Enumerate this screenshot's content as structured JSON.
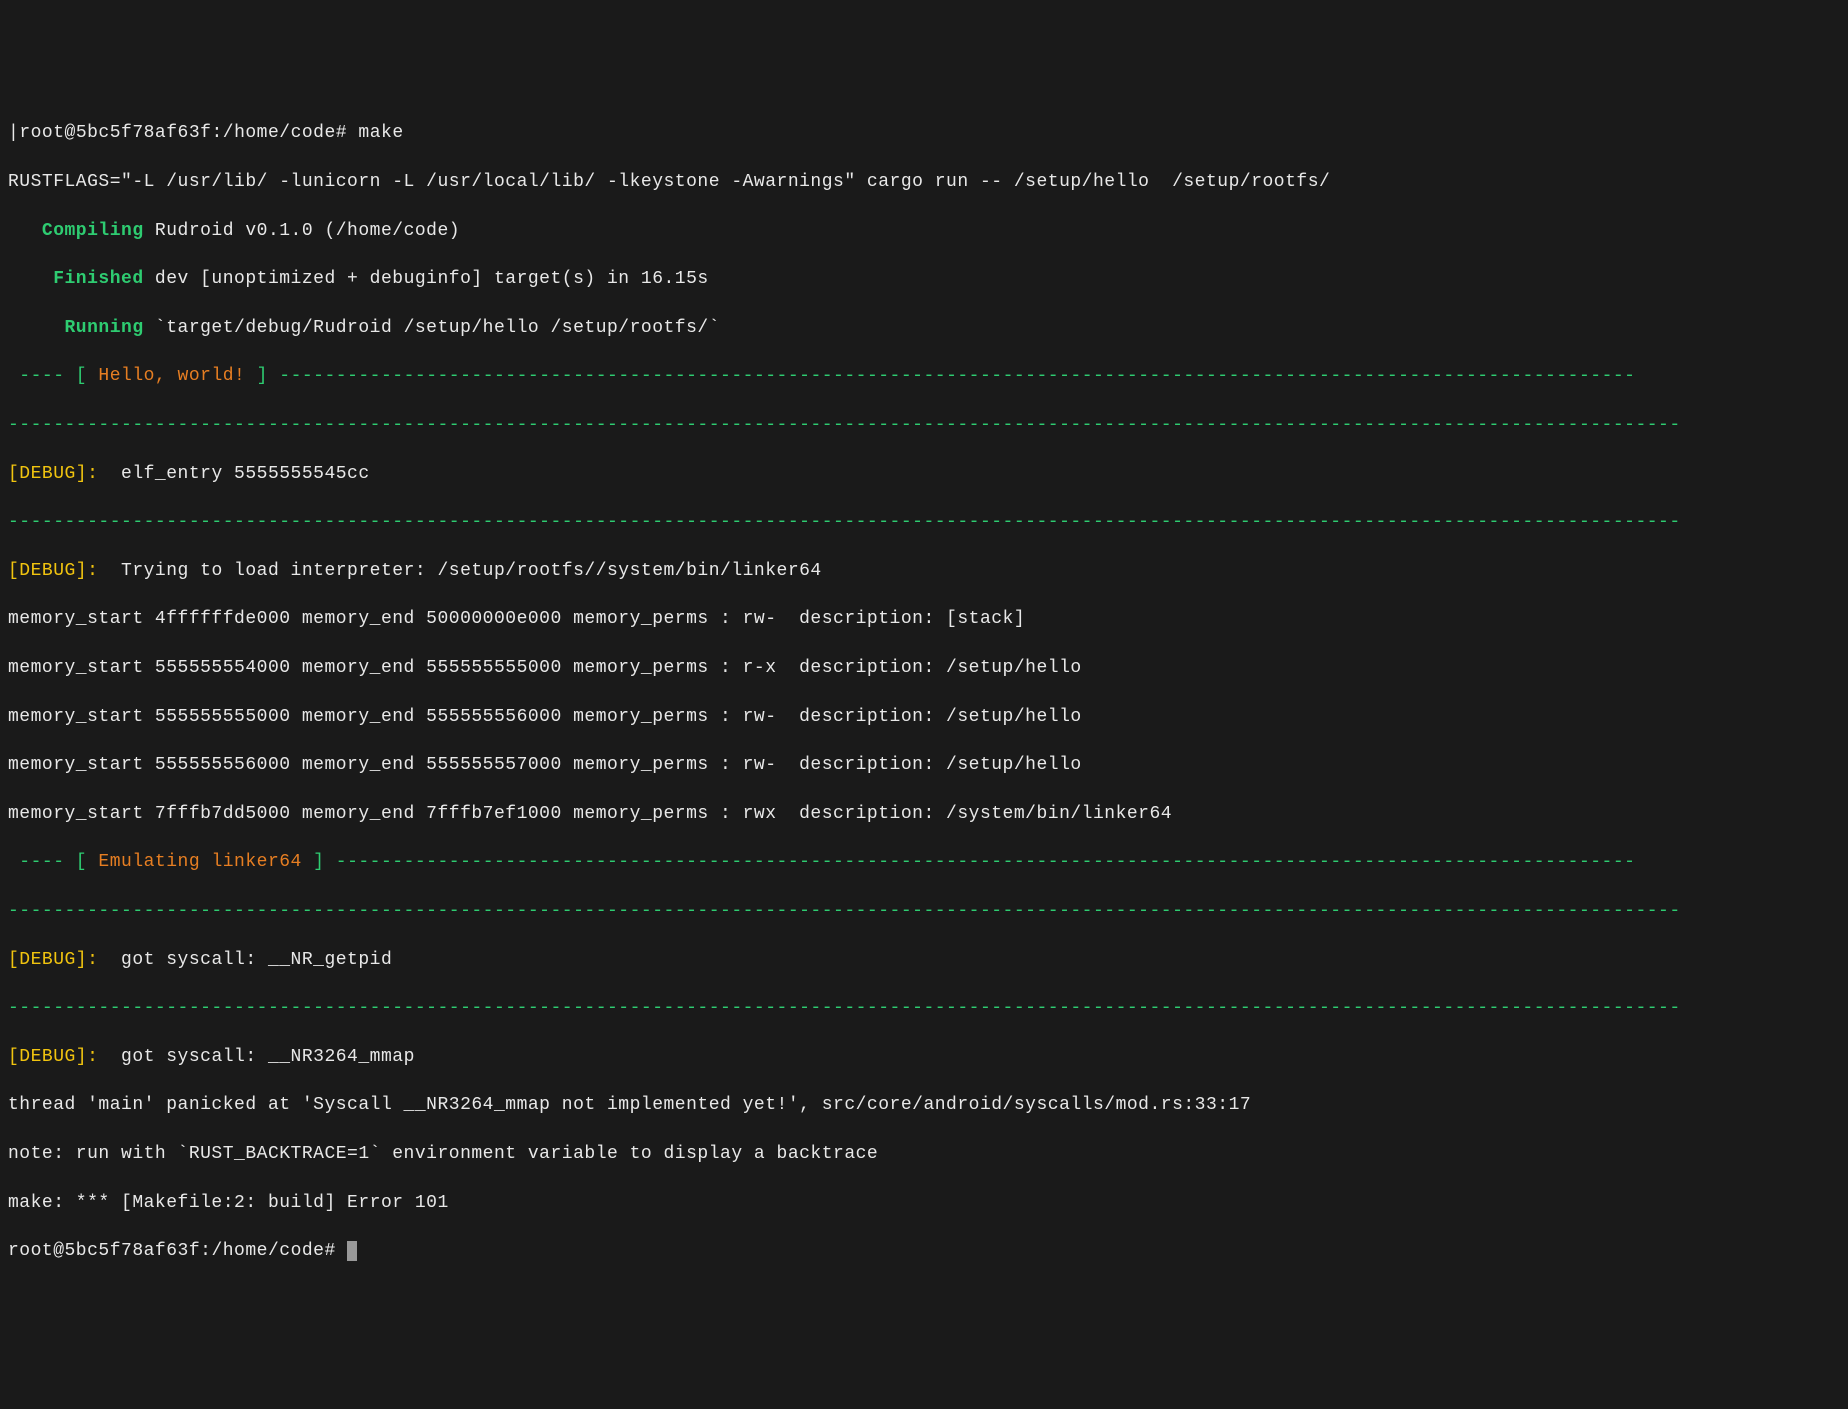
{
  "prompt1": {
    "bracket_open": "|",
    "user": "root@5bc5f78af63f",
    "colon": ":",
    "path": "/home/code",
    "sep": "#",
    "cmd": " make"
  },
  "rustflags_line": "RUSTFLAGS=\"-L /usr/lib/ -lunicorn -L /usr/local/lib/ -lkeystone -Awarnings\" cargo run -- /setup/hello  /setup/rootfs/",
  "compiling": {
    "label": "   Compiling",
    "rest": " Rudroid v0.1.0 (/home/code)"
  },
  "finished": {
    "label": "    Finished",
    "rest": " dev [unoptimized + debuginfo] target(s) in 16.15s"
  },
  "running": {
    "label": "     Running",
    "rest": " `target/debug/Rudroid /setup/hello /setup/rootfs/`"
  },
  "banner1": {
    "pre": " ---- [ ",
    "msg": "Hello, world!",
    "post": " ] ------------------------------------------------------------------------------------------------------------------------"
  },
  "hr": "----------------------------------------------------------------------------------------------------------------------------------------------------",
  "debug1": {
    "label": "[DEBUG]:",
    "rest": "  elf_entry 5555555545cc"
  },
  "debug2": {
    "label": "[DEBUG]:",
    "rest": "  Trying to load interpreter: /setup/rootfs//system/bin/linker64"
  },
  "mem": [
    "memory_start 4ffffffde000 memory_end 50000000e000 memory_perms : rw-  description: [stack]",
    "memory_start 555555554000 memory_end 555555555000 memory_perms : r-x  description: /setup/hello",
    "memory_start 555555555000 memory_end 555555556000 memory_perms : rw-  description: /setup/hello",
    "memory_start 555555556000 memory_end 555555557000 memory_perms : rw-  description: /setup/hello",
    "memory_start 7fffb7dd5000 memory_end 7fffb7ef1000 memory_perms : rwx  description: /system/bin/linker64"
  ],
  "banner2": {
    "pre": " ---- [ ",
    "msg": "Emulating linker64",
    "post": " ] -------------------------------------------------------------------------------------------------------------------"
  },
  "debug3": {
    "label": "[DEBUG]:",
    "rest": "  got syscall: __NR_getpid"
  },
  "debug4": {
    "label": "[DEBUG]:",
    "rest": "  got syscall: __NR3264_mmap"
  },
  "panic": "thread 'main' panicked at 'Syscall __NR3264_mmap not implemented yet!', src/core/android/syscalls/mod.rs:33:17",
  "note": "note: run with `RUST_BACKTRACE=1` environment variable to display a backtrace",
  "makeerr": "make: *** [Makefile:2: build] Error 101",
  "prompt2": {
    "user": "root@5bc5f78af63f",
    "colon": ":",
    "path": "/home/code",
    "sep": "#"
  }
}
